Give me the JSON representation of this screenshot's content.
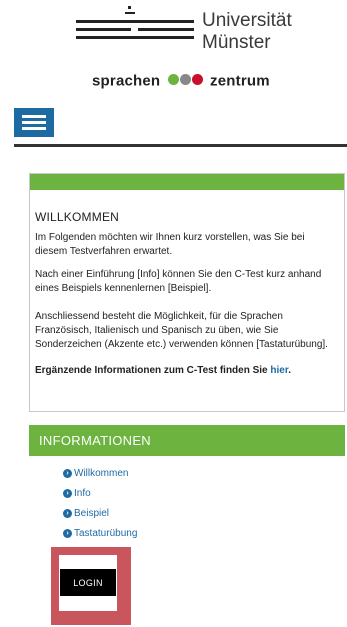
{
  "logo": {
    "university_line1": "Universität",
    "university_line2": "Münster",
    "sprachen": "sprachen",
    "zentrum": "zentrum",
    "dot_colors": [
      "#6cb33f",
      "#888888",
      "#c8102e"
    ]
  },
  "header": {
    "menu_icon": "hamburger-menu-icon"
  },
  "welcome": {
    "title": "WILLKOMMEN",
    "p1": "Im Folgenden möchten wir Ihnen kurz vorstellen, was Sie bei diesem Testverfahren erwartet.",
    "p2": "Nach einer Einführung [Info] können Sie den C-Test kurz anhand eines Beispiels kennenlernen [Beispiel].",
    "p3": "Anschliessend besteht die Möglichkeit, für die Sprachen Französisch, Italienisch und Spanisch zu üben, wie Sie Sonderzeichen (Akzente etc.) verwenden können [Tastaturübung].",
    "more_text": "Ergänzende Informationen zum C-Test finden Sie ",
    "more_link": "hier",
    "more_end": "."
  },
  "informationen": {
    "title": "INFORMATIONEN",
    "items": [
      {
        "label": "Willkommen"
      },
      {
        "label": "Info"
      },
      {
        "label": "Beispiel"
      },
      {
        "label": "Tastaturübung"
      }
    ]
  },
  "login": {
    "label": "LOGIN"
  },
  "colors": {
    "accent_green": "#6cb33f",
    "link_blue": "#1e6aa3",
    "login_frame": "#c9565c"
  }
}
